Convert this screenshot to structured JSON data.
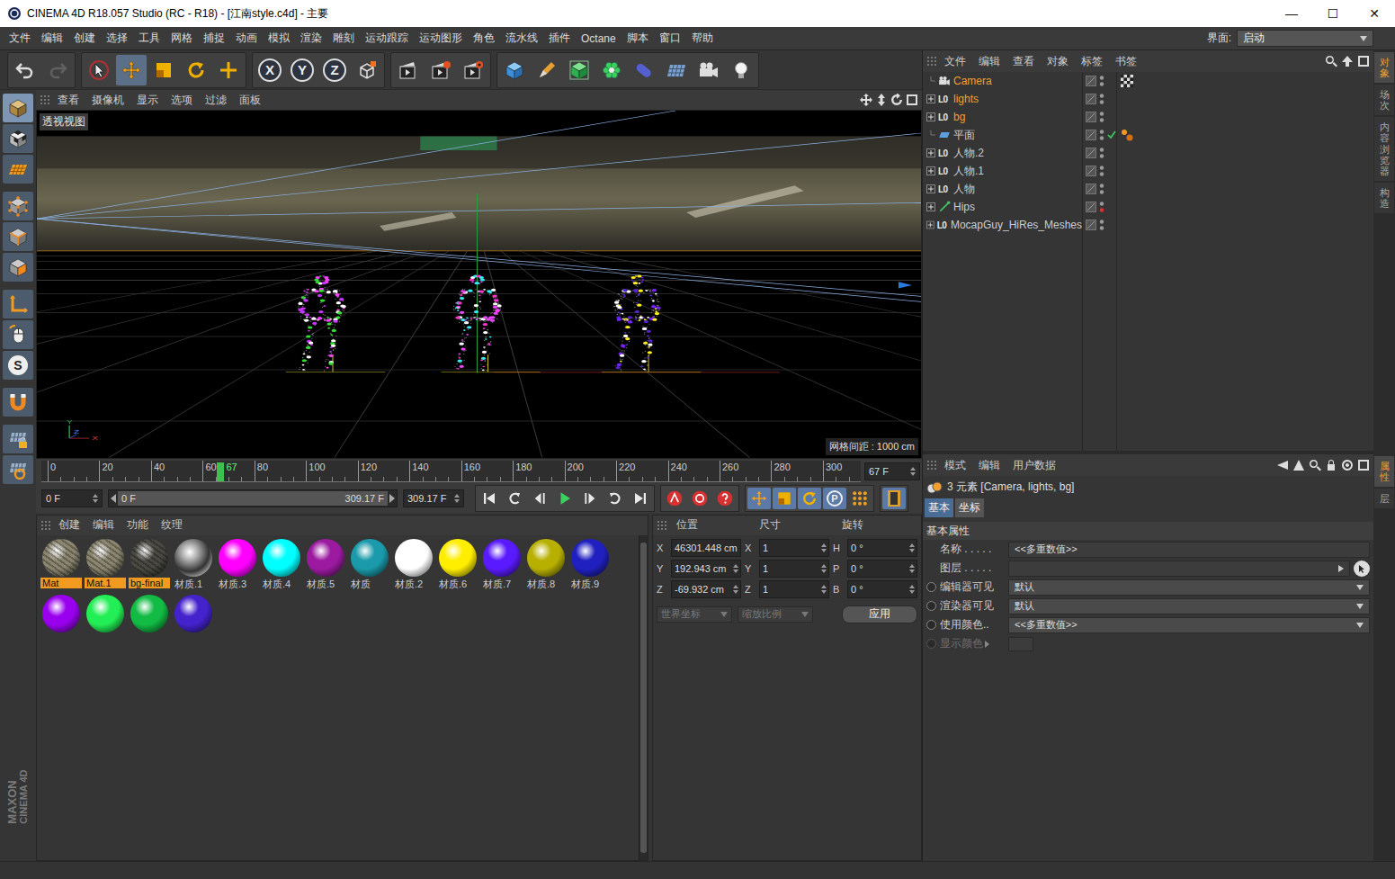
{
  "window": {
    "title": "CINEMA 4D R18.057 Studio (RC - R18) - [江南style.c4d] - 主要",
    "controls": [
      "—",
      "☐",
      "✕"
    ]
  },
  "menu": [
    "文件",
    "编辑",
    "创建",
    "选择",
    "工具",
    "网格",
    "捕捉",
    "动画",
    "模拟",
    "渲染",
    "雕刻",
    "运动跟踪",
    "运动图形",
    "角色",
    "流水线",
    "插件",
    "Octane",
    "脚本",
    "窗口",
    "帮助"
  ],
  "layout_picker": {
    "label": "界面:",
    "value": "启动"
  },
  "toolbar": [
    {
      "items": [
        {
          "kind": "undo",
          "disabled": false
        },
        {
          "kind": "redo",
          "disabled": true
        }
      ]
    },
    {
      "items": [
        {
          "kind": "select",
          "selected": false
        },
        {
          "kind": "move",
          "selected": true
        },
        {
          "kind": "scale",
          "selected": false
        },
        {
          "kind": "rotate",
          "selected": false
        },
        {
          "kind": "add",
          "selected": false
        }
      ]
    },
    {
      "items": [
        {
          "kind": "axis",
          "label": "X",
          "selected": true
        },
        {
          "kind": "axis",
          "label": "Y",
          "selected": true
        },
        {
          "kind": "axis",
          "label": "Z",
          "selected": true
        },
        {
          "kind": "coord",
          "selected": false
        }
      ]
    },
    {
      "items": [
        {
          "kind": "render-view"
        },
        {
          "kind": "render"
        },
        {
          "kind": "render-settings"
        }
      ]
    },
    {
      "items": [
        {
          "kind": "cube"
        },
        {
          "kind": "pen"
        },
        {
          "kind": "subdivision"
        },
        {
          "kind": "cloner"
        },
        {
          "kind": "deformer"
        },
        {
          "kind": "floor"
        },
        {
          "kind": "camera"
        },
        {
          "kind": "light"
        }
      ]
    }
  ],
  "left_tools": [
    {
      "kind": "model",
      "selected": true
    },
    {
      "kind": "texture",
      "selected": false
    },
    {
      "kind": "workplane",
      "selected": false
    },
    {
      "kind": "points",
      "selected": false
    },
    {
      "kind": "edges",
      "selected": false
    },
    {
      "kind": "polygons",
      "selected": false
    },
    {
      "kind": "axis-mode",
      "selected": false
    },
    {
      "kind": "tweak",
      "selected": false
    },
    {
      "kind": "snap",
      "label": "S",
      "selected": false
    },
    {
      "kind": "magnet",
      "selected": false
    },
    {
      "kind": "workplane-lock",
      "selected": false
    },
    {
      "kind": "quantize",
      "selected": false
    }
  ],
  "logo": [
    "MAXON",
    "CINEMA 4D"
  ],
  "viewport": {
    "menu": [
      "查看",
      "摄像机",
      "显示",
      "选项",
      "过滤",
      "面板"
    ],
    "label": "透视视图",
    "grid_spacing": "网格间距 : 1000 cm",
    "axis_labels": [
      "Y",
      "Z",
      "X"
    ],
    "figures": [
      {
        "colors": [
          "#ffffff",
          "#33dd33",
          "#cc33ff",
          "#ff44ff"
        ]
      },
      {
        "colors": [
          "#ffffff",
          "#33eeee",
          "#ff33cc",
          "#ee44ff"
        ]
      },
      {
        "colors": [
          "#ffffff",
          "#ffee22",
          "#7722ff",
          "#5522cc"
        ]
      }
    ]
  },
  "timeline": {
    "ruler": [
      "0",
      "20",
      "40",
      "60",
      "80",
      "100",
      "120",
      "140",
      "160",
      "180",
      "200",
      "220",
      "240",
      "260",
      "280",
      "300"
    ],
    "current": "67",
    "frame_field": "67 F"
  },
  "transport": {
    "start_field": "0 F",
    "range_start": "0 F",
    "range_end": "309.17 F",
    "end_field": "309.17 F",
    "buttons": [
      {
        "kind": "to-start"
      },
      {
        "kind": "prev-key"
      },
      {
        "kind": "prev-frame"
      },
      {
        "kind": "play"
      },
      {
        "kind": "next-frame"
      },
      {
        "kind": "next-key"
      },
      {
        "kind": "to-end"
      }
    ],
    "record": [
      {
        "kind": "record"
      },
      {
        "kind": "autokey"
      },
      {
        "kind": "key-help"
      }
    ],
    "keys": [
      {
        "kind": "key-move",
        "selected": true
      },
      {
        "kind": "key-scale",
        "selected": true
      },
      {
        "kind": "key-rotate",
        "selected": true
      },
      {
        "kind": "key-param",
        "label": "P",
        "selected": true
      },
      {
        "kind": "key-pla",
        "selected": false
      }
    ]
  },
  "materials": {
    "menu": [
      "创建",
      "编辑",
      "功能",
      "纹理"
    ],
    "items": [
      {
        "name": "Mat",
        "kind": "texture",
        "color": "#8a8670",
        "selected": true
      },
      {
        "name": "Mat.1",
        "kind": "texture",
        "color": "#8a8670",
        "selected": true
      },
      {
        "name": "bg-final",
        "kind": "texture",
        "color": "#4a4a42",
        "selected": true
      },
      {
        "name": "材质.1",
        "kind": "chrome",
        "color": "#9a9a9a",
        "selected": false
      },
      {
        "name": "材质.3",
        "kind": "color",
        "color": "#ff00ff",
        "selected": false
      },
      {
        "name": "材质.4",
        "kind": "color",
        "color": "#00ffff",
        "selected": false
      },
      {
        "name": "材质.5",
        "kind": "color",
        "color": "#9b1aa0",
        "selected": false
      },
      {
        "name": "材质",
        "kind": "color",
        "color": "#1a9aaa",
        "selected": false
      },
      {
        "name": "材质.2",
        "kind": "color",
        "color": "#ffffff",
        "selected": false
      },
      {
        "name": "材质.6",
        "kind": "color",
        "color": "#ffee00",
        "selected": false
      },
      {
        "name": "材质.7",
        "kind": "color",
        "color": "#5a1aff",
        "selected": false
      },
      {
        "name": "材质.8",
        "kind": "color",
        "color": "#b8b000",
        "selected": false
      },
      {
        "name": "材质.9",
        "kind": "color",
        "color": "#2020c0",
        "selected": false
      }
    ],
    "overflow": [
      {
        "kind": "color",
        "color": "#9900ee"
      },
      {
        "kind": "color",
        "color": "#22ee55"
      },
      {
        "kind": "color",
        "color": "#11bb44"
      },
      {
        "kind": "color",
        "color": "#4422cc"
      }
    ]
  },
  "coordinates": {
    "headers": [
      "位置",
      "尺寸",
      "旋转"
    ],
    "rows": [
      {
        "pos_axis": "X",
        "position": "46301.448 cm",
        "size_axis": "X",
        "size": "1",
        "rot_axis": "H",
        "rotation": "0 °"
      },
      {
        "pos_axis": "Y",
        "position": "192.943 cm",
        "size_axis": "Y",
        "size": "1",
        "rot_axis": "P",
        "rotation": "0 °"
      },
      {
        "pos_axis": "Z",
        "position": "-69.932 cm",
        "size_axis": "Z",
        "size": "1",
        "rot_axis": "B",
        "rotation": "0 °"
      }
    ],
    "mode": {
      "value": "世界坐标",
      "disabled": true
    },
    "scale_mode": {
      "value": "缩放比例",
      "disabled": true
    },
    "apply": "应用"
  },
  "object_manager": {
    "menu": [
      "文件",
      "编辑",
      "查看",
      "对象",
      "标签",
      "书签"
    ],
    "objects": [
      {
        "name": "Camera",
        "kind": "camera",
        "selected": true,
        "expandable": false,
        "checked": false,
        "render_dot": "#9a9a9a",
        "tags": [
          "protection"
        ]
      },
      {
        "name": "lights",
        "kind": "null",
        "glyph": "L0",
        "selected": true,
        "expandable": true,
        "checked": false,
        "render_dot": "#9a9a9a",
        "tags": []
      },
      {
        "name": "bg",
        "kind": "null",
        "glyph": "L0",
        "selected": true,
        "expandable": true,
        "checked": false,
        "render_dot": "#9a9a9a",
        "tags": []
      },
      {
        "name": "平面",
        "kind": "plane",
        "selected": false,
        "expandable": false,
        "checked": true,
        "render_dot": "#9a9a9a",
        "tags": [
          "material"
        ]
      },
      {
        "name": "人物.2",
        "kind": "null",
        "glyph": "L0",
        "selected": false,
        "expandable": true,
        "checked": false,
        "render_dot": "#9a9a9a",
        "tags": []
      },
      {
        "name": "人物.1",
        "kind": "null",
        "glyph": "L0",
        "selected": false,
        "expandable": true,
        "checked": false,
        "render_dot": "#9a9a9a",
        "tags": []
      },
      {
        "name": "人物",
        "kind": "null",
        "glyph": "L0",
        "selected": false,
        "expandable": true,
        "checked": false,
        "render_dot": "#9a9a9a",
        "tags": []
      },
      {
        "name": "Hips",
        "kind": "joint",
        "selected": false,
        "expandable": true,
        "checked": false,
        "render_dot": "#e03030",
        "tags": []
      },
      {
        "name": "MocapGuy_HiRes_Meshes",
        "kind": "null",
        "glyph": "L0",
        "selected": false,
        "expandable": true,
        "checked": false,
        "render_dot": "#9a9a9a",
        "tags": []
      }
    ]
  },
  "attributes": {
    "menu": [
      "模式",
      "编辑",
      "用户数据"
    ],
    "summary": "3 元素 [Camera, lights, bg]",
    "tabs": [
      {
        "label": "基本",
        "selected": true
      },
      {
        "label": "坐标",
        "selected": false
      }
    ],
    "section": "基本属性",
    "fields": [
      {
        "label": "名称 . . . . .",
        "value": "<<多重数值>>",
        "kind": "text",
        "radio": false,
        "disabled": false
      },
      {
        "label": "图层 . . . . .",
        "value": "",
        "kind": "link",
        "radio": false,
        "disabled": false
      },
      {
        "label": "编辑器可见",
        "value": "默认",
        "kind": "select",
        "radio": true,
        "disabled": false
      },
      {
        "label": "渲染器可见",
        "value": "默认",
        "kind": "select",
        "radio": true,
        "disabled": false
      },
      {
        "label": "使用颜色..",
        "value": "<<多重数值>>",
        "kind": "select",
        "radio": true,
        "disabled": false
      },
      {
        "label": "显示颜色",
        "value": "",
        "kind": "color",
        "radio": true,
        "disabled": true
      }
    ]
  },
  "side_tabs": {
    "top": [
      {
        "label": "对象",
        "selected": true
      },
      {
        "label": "场次",
        "selected": false
      },
      {
        "label": "内容浏览器",
        "selected": false
      },
      {
        "label": "构造",
        "selected": false
      }
    ],
    "bottom": [
      {
        "label": "属性",
        "selected": true
      },
      {
        "label": "层",
        "selected": false
      }
    ]
  }
}
